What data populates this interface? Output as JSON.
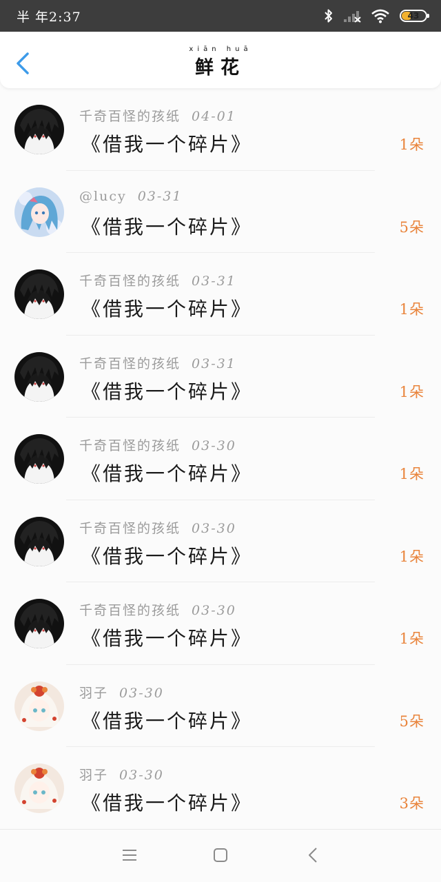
{
  "status_bar": {
    "time": "半 年2:37",
    "battery": "43",
    "battery_level": 0.43
  },
  "header": {
    "title": "鲜花",
    "title_pinyin": "xiān huā",
    "back_icon": "chevron-left-icon"
  },
  "colors": {
    "accent": "#3d9be9",
    "flower": "#e9833a",
    "status_bg": "#3d3d3d",
    "battery": "#f3b22f"
  },
  "items": [
    {
      "sender": "千奇百怪的孩纸",
      "date": "04-01",
      "message": "《借我一个碎片》",
      "count": "1朵",
      "avatar": "dark-hair-avatar"
    },
    {
      "sender": "@lucy",
      "date": "03-31",
      "message": "《借我一个碎片》",
      "count": "5朵",
      "avatar": "blue-hair-avatar"
    },
    {
      "sender": "千奇百怪的孩纸",
      "date": "03-31",
      "message": "《借我一个碎片》",
      "count": "1朵",
      "avatar": "dark-hair-avatar"
    },
    {
      "sender": "千奇百怪的孩纸",
      "date": "03-31",
      "message": "《借我一个碎片》",
      "count": "1朵",
      "avatar": "dark-hair-avatar"
    },
    {
      "sender": "千奇百怪的孩纸",
      "date": "03-30",
      "message": "《借我一个碎片》",
      "count": "1朵",
      "avatar": "dark-hair-avatar"
    },
    {
      "sender": "千奇百怪的孩纸",
      "date": "03-30",
      "message": "《借我一个碎片》",
      "count": "1朵",
      "avatar": "dark-hair-avatar"
    },
    {
      "sender": "千奇百怪的孩纸",
      "date": "03-30",
      "message": "《借我一个碎片》",
      "count": "1朵",
      "avatar": "dark-hair-avatar"
    },
    {
      "sender": "羽子",
      "date": "03-30",
      "message": "《借我一个碎片》",
      "count": "5朵",
      "avatar": "white-hair-avatar"
    },
    {
      "sender": "羽子",
      "date": "03-30",
      "message": "《借我一个碎片》",
      "count": "3朵",
      "avatar": "white-hair-avatar"
    }
  ],
  "nav_bar": {
    "menu_icon": "menu-icon",
    "home_icon": "home-square-icon",
    "back_icon": "back-triangle-icon"
  }
}
